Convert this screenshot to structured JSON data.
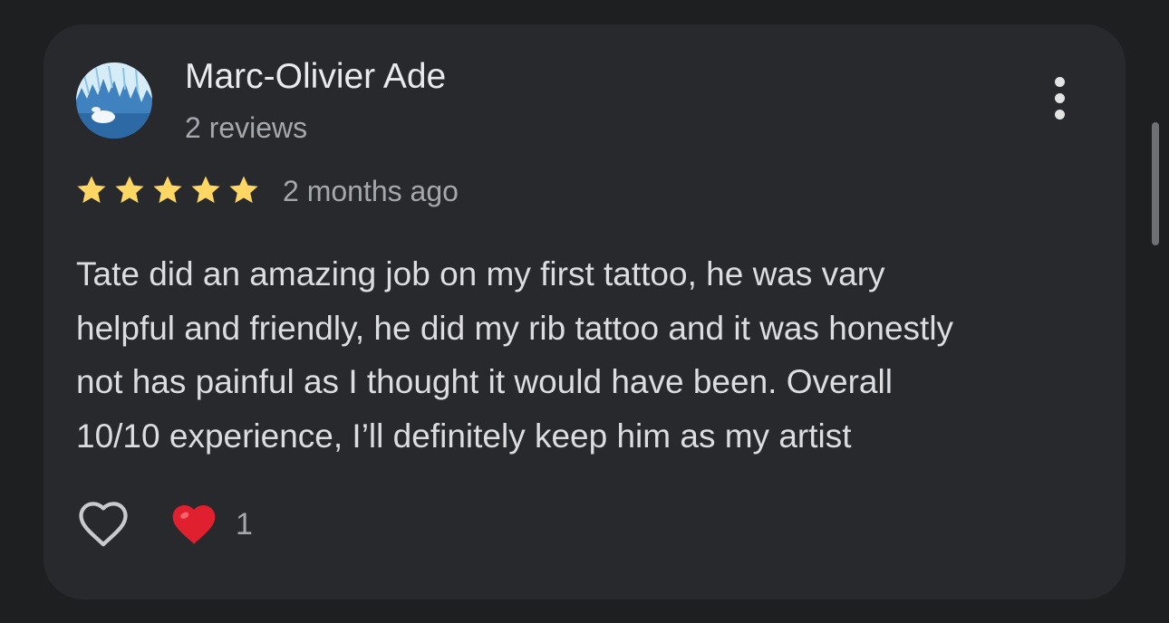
{
  "review": {
    "author": "Marc-Olivier Ade",
    "author_meta": "2 reviews",
    "rating": 5,
    "rating_max": 5,
    "date": "2 months ago",
    "text_lines": [
      "Tate did an amazing job on my first tattoo, he was vary",
      "helpful and friendly, he did my rib tattoo and it was honestly",
      "not has painful as I thought it would have been. Overall",
      "10/10 experience, I’ll definitely keep him as my artist"
    ],
    "reaction_count": "1"
  },
  "icons": {
    "avatar": "avatar-image",
    "more": "more-vert-icon",
    "star": "star-icon",
    "like": "heart-outline-icon",
    "reaction": "red-heart-icon"
  },
  "colors": {
    "background": "#1e1f21",
    "card": "#28292c",
    "star": "#fdd663",
    "primary_text": "#e8eaed",
    "secondary_text": "#a4a7ab",
    "heart": "#e0202e"
  }
}
